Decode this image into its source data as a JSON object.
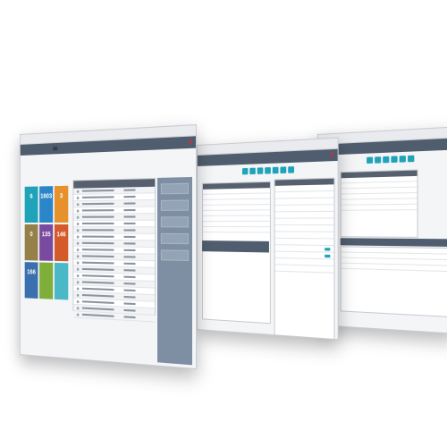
{
  "colors": {
    "nav_bg": "#4f5d6e",
    "accent_teal": "#1fa3b8",
    "logo_red": "#d03030",
    "side_panel": "#7f8fa3"
  },
  "icons": [
    "logo-x-icon",
    "toolbar-teal-icon"
  ],
  "screen_front": {
    "tiles": [
      {
        "value": "6",
        "color": "#1fa3b8"
      },
      {
        "value": "1603",
        "color": "#2a86c9"
      },
      {
        "value": "3",
        "color": "#e7912c"
      },
      {
        "value": "0",
        "color": "#95804a"
      },
      {
        "value": "135",
        "color": "#7a4aa0"
      },
      {
        "value": "146",
        "color": "#d45a2a"
      },
      {
        "value": "166",
        "color": "#3a6fb0"
      },
      {
        "value": "",
        "color": "#7fae3a"
      },
      {
        "value": "",
        "color": "#4bb8c8"
      }
    ]
  }
}
